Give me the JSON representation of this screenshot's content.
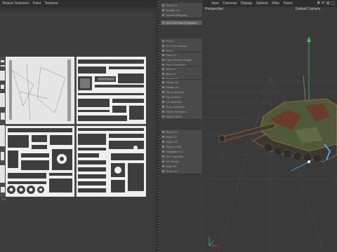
{
  "uv_editor": {
    "menu": [
      "Texture Selection",
      "Paint",
      "Textures"
    ],
    "header_icons": "⤢ ⊡",
    "axis_bottom": "1,0"
  },
  "tools": {
    "groups": [
      {
        "items": [
          "Relax UV",
          "Realign UV",
          "Optimal Mapping"
        ]
      },
      {
        "items": [
          "Set UVW from Projection..."
        ],
        "highlight": 0
      },
      {
        "items": [
          "Fit UV",
          "Fit UV to Canvas",
          "Fit UV"
        ]
      },
      {
        "items": [
          "Pack UV",
          "Pack Shortest Edges",
          "Pack Geometric"
        ]
      },
      {
        "items": [
          "Mirror U",
          "Mirror V",
          "Rotate UV"
        ]
      },
      {
        "items": [
          "Rotate 90",
          "Rotate -90",
          "Flip Horizontal",
          "Flip Vertical",
          "UV Distortion",
          "Grow Selection",
          "Shrink Selection",
          "Select Island"
        ]
      },
      {
        "items": [
          "Break UV",
          "Weld UV",
          "Stitch UV",
          "Align to Grid",
          "Straighten UV",
          "Set Projection",
          "UV Terrain",
          "Align UV",
          "Scale UV"
        ]
      }
    ]
  },
  "viewport": {
    "menu": [
      "View",
      "Cameras",
      "Display",
      "Options",
      "Filter",
      "Panel"
    ],
    "name": "Perspective",
    "camera": "Default Camera",
    "header_icons": "✥ ⟳ ⊞ ▢"
  },
  "colors": {
    "accent_blue": "#4aa3ff",
    "axis_green": "#38c25a",
    "axis_red": "#d9463a",
    "tank_body": "#4f5a3a",
    "tank_camo": "#6b3a2a",
    "selection_orange": "#e07a2e"
  }
}
